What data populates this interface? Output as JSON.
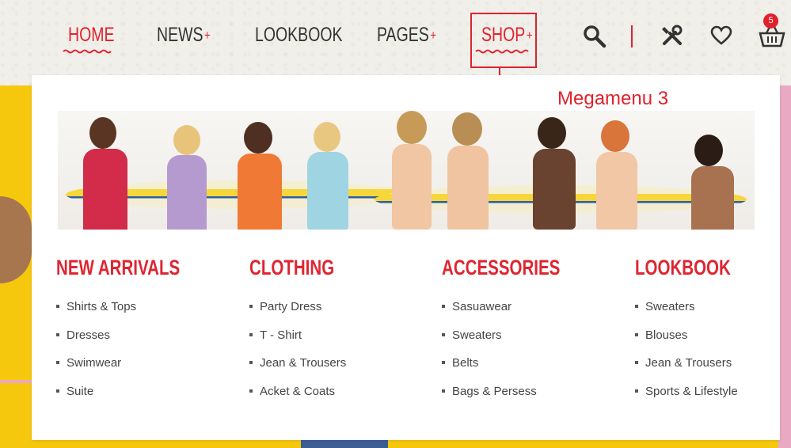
{
  "nav": {
    "items": [
      {
        "label": "HOME",
        "plus": ""
      },
      {
        "label": "NEWS",
        "plus": "+"
      },
      {
        "label": "LOOKBOOK",
        "plus": ""
      },
      {
        "label": "PAGES",
        "plus": "+"
      },
      {
        "label": "SHOP",
        "plus": "+"
      }
    ],
    "active": "HOME",
    "highlighted": "SHOP",
    "icons": [
      "search-icon",
      "tools-icon",
      "heart-icon",
      "basket-icon"
    ],
    "cart_count": "5"
  },
  "annotation": "Megamenu 3",
  "megamenu": {
    "columns": [
      {
        "title": "NEW ARRIVALS",
        "links": [
          "Shirts & Tops",
          "Dresses",
          "Swimwear",
          "Suite"
        ]
      },
      {
        "title": "CLOTHING",
        "links": [
          "Party Dress",
          "T - Shirt",
          "Jean & Trousers",
          "Acket & Coats"
        ]
      },
      {
        "title": "ACCESSORIES",
        "links": [
          "Sasuawear",
          "Sweaters",
          "Belts",
          "Bags & Persess"
        ]
      },
      {
        "title": "LOOKBOOK",
        "links": [
          "Sweaters",
          "Blouses",
          "Jean & Trousers",
          "Sports & Lifestyle"
        ]
      }
    ]
  },
  "colors": {
    "accent": "#e0222d",
    "yellow": "#f6c80d",
    "pink": "#e9a9c2"
  }
}
